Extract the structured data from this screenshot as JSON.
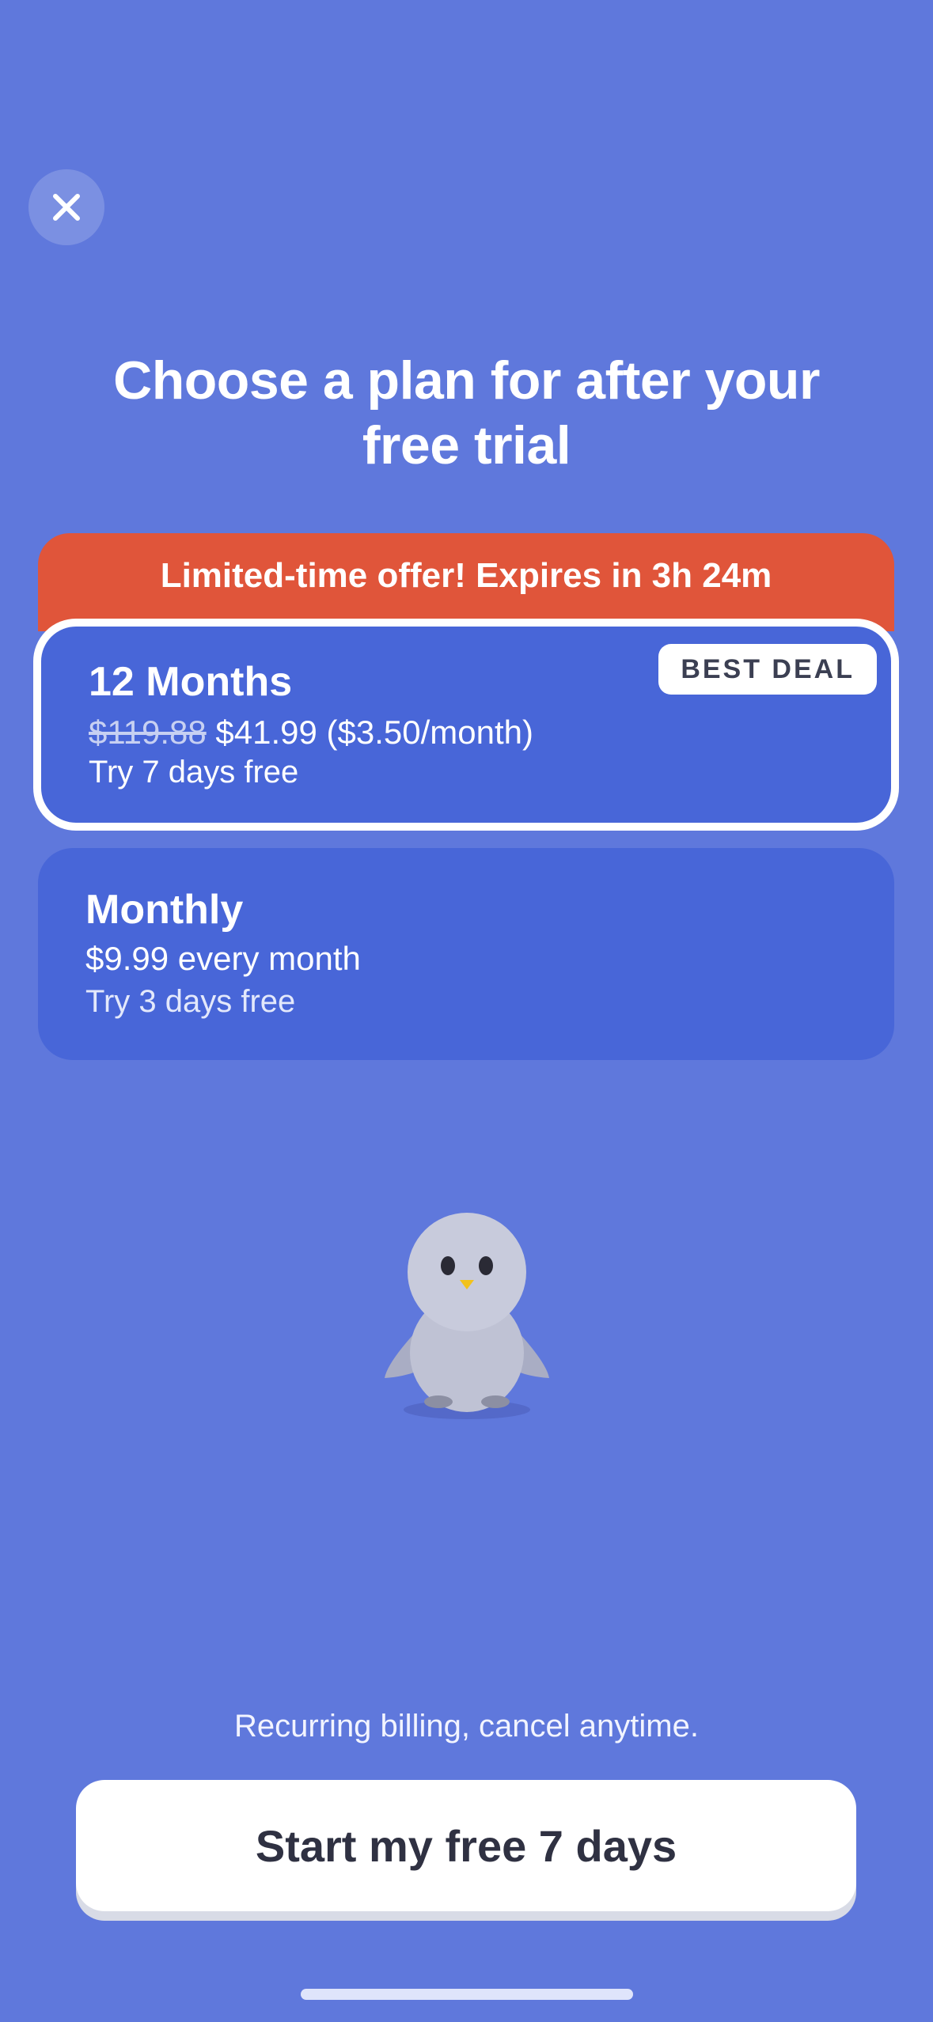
{
  "header": {
    "close_icon": "close-icon",
    "title_line1": "Choose a plan for after your",
    "title_line2": "free trial"
  },
  "offer": {
    "text": "Limited-time offer! Expires in 3h 24m",
    "color": "#e0553a"
  },
  "plans": [
    {
      "name": "12 Months",
      "original_price": "$119.88",
      "price": "$41.99 ($3.50/month)",
      "trial": "Try 7 days free",
      "badge": "BEST DEAL",
      "selected": true
    },
    {
      "name": "Monthly",
      "price": "$9.99 every month",
      "trial": "Try 3 days free",
      "selected": false
    }
  ],
  "mascot": "penguin-mascot",
  "footer": {
    "note": "Recurring billing, cancel anytime.",
    "cta_label": "Start my free 7 days"
  },
  "colors": {
    "background": "#5f78dc",
    "card": "#4866d8",
    "accent": "#e0553a"
  }
}
